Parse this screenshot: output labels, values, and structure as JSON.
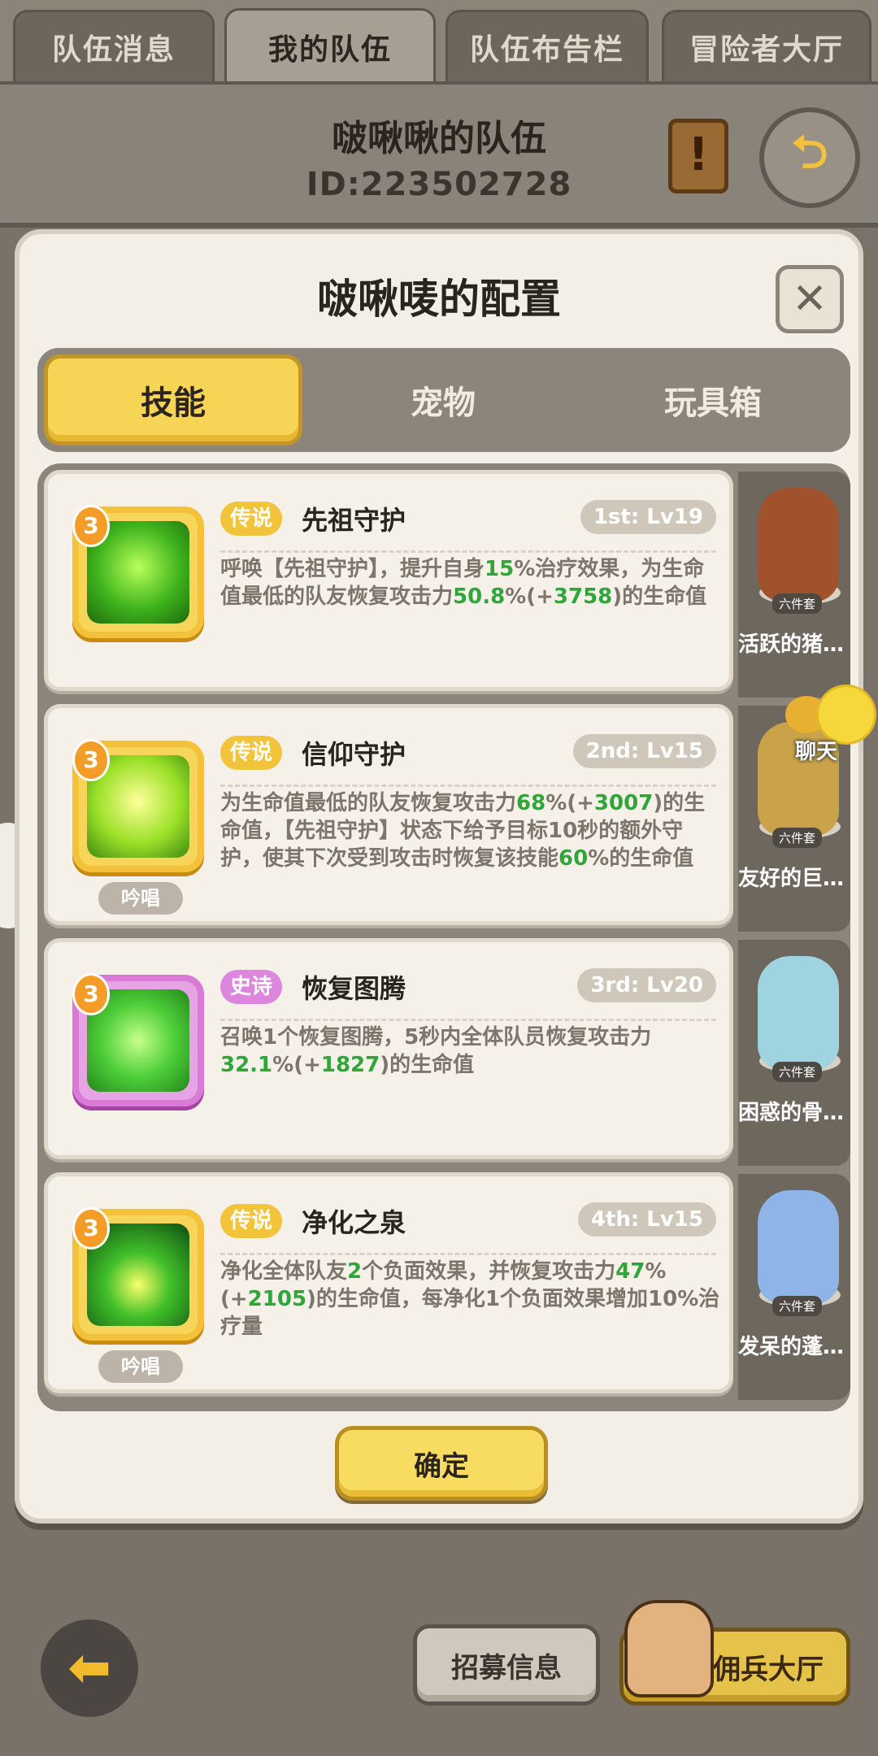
{
  "top_tabs": [
    "队伍消息",
    "我的队伍",
    "队伍布告栏",
    "冒险者大厅"
  ],
  "team": {
    "name": "啵啾啾的队伍",
    "id": "ID:223502728"
  },
  "dialog": {
    "title": "啵啾唛的配置",
    "tabs": [
      "技能",
      "宠物",
      "玩具箱"
    ],
    "confirm_label": "确定"
  },
  "skills": [
    {
      "level": "3",
      "rarity": "传说",
      "name": "先祖守护",
      "slot": "1st: Lv19",
      "desc": [
        {
          "t": "呼唤【先祖守护】，提升自身",
          "h": false
        },
        {
          "t": "15",
          "h": true
        },
        {
          "t": "%治疗效果，为生命值最低的队友恢复攻击力",
          "h": false
        },
        {
          "t": "50.8",
          "h": true
        },
        {
          "t": "%(+",
          "h": false
        },
        {
          "t": "3758",
          "h": true
        },
        {
          "t": ")的生命值",
          "h": false
        }
      ],
      "chant": ""
    },
    {
      "level": "3",
      "rarity": "传说",
      "name": "信仰守护",
      "slot": "2nd: Lv15",
      "desc": [
        {
          "t": "为生命值最低的队友恢复攻击力",
          "h": false
        },
        {
          "t": "68",
          "h": true
        },
        {
          "t": "%(+",
          "h": false
        },
        {
          "t": "3007",
          "h": true
        },
        {
          "t": ")的生命值，【先祖守护】状态下给予目标10秒的额外守护，使其下次受到攻击时恢复该技能",
          "h": false
        },
        {
          "t": "60",
          "h": true
        },
        {
          "t": "%的生命值",
          "h": false
        }
      ],
      "chant": "吟唱"
    },
    {
      "level": "3",
      "rarity": "史诗",
      "name": "恢复图腾",
      "slot": "3rd: Lv20",
      "desc": [
        {
          "t": "召唤1个恢复图腾，5秒内全体队员恢复攻击力",
          "h": false
        },
        {
          "t": "32.1",
          "h": true
        },
        {
          "t": "%(+",
          "h": false
        },
        {
          "t": "1827",
          "h": true
        },
        {
          "t": ")的生命值",
          "h": false
        }
      ],
      "chant": ""
    },
    {
      "level": "3",
      "rarity": "传说",
      "name": "净化之泉",
      "slot": "4th: Lv15",
      "desc": [
        {
          "t": "净化全体队友",
          "h": false
        },
        {
          "t": "2",
          "h": true
        },
        {
          "t": "个负面效果，并恢复攻击力",
          "h": false
        },
        {
          "t": "47",
          "h": true
        },
        {
          "t": "%(+",
          "h": false
        },
        {
          "t": "2105",
          "h": true
        },
        {
          "t": ")的生命值，每净化1个负面效果增加10%治疗量",
          "h": false
        }
      ],
      "chant": "吟唱"
    }
  ],
  "pets": [
    {
      "name": "活跃的猪…",
      "badge": "六件套"
    },
    {
      "name": "友好的巨…",
      "badge": "六件套"
    },
    {
      "name": "困惑的骨…",
      "badge": "六件套"
    },
    {
      "name": "发呆的蓬…",
      "badge": "六件套"
    }
  ],
  "chat_label": "聊天",
  "bottom": {
    "recruit": "招募信息",
    "mercenary": "佣兵大厅"
  },
  "colors": {
    "legendary": "#f2c43b",
    "epic": "#dc86de",
    "highlight": "#2fa53a",
    "tab_active": "#f6d556"
  }
}
